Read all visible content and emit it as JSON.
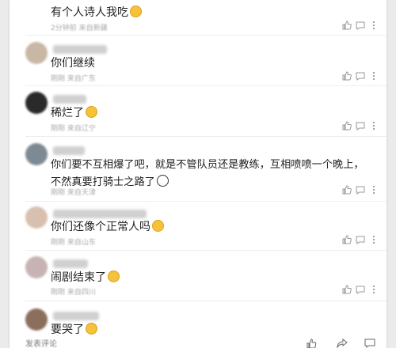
{
  "comments": [
    {
      "username_hidden": true,
      "text": "有个人诗人我吃",
      "emoji": "smile-emoji",
      "meta": "2分钟前 来自新疆",
      "actions": [
        "like-icon",
        "comment-icon",
        "more-icon"
      ]
    },
    {
      "username_hidden": true,
      "text": "你们继续",
      "emoji": "",
      "meta": "刚刚 来自广东",
      "actions": [
        "like-icon",
        "comment-icon",
        "more-icon"
      ]
    },
    {
      "username_hidden": true,
      "text": "稀烂了",
      "emoji": "smirk-emoji",
      "meta": "刚刚 来自辽宁",
      "actions": [
        "like-icon",
        "comment-icon",
        "more-icon"
      ]
    },
    {
      "username_hidden": true,
      "text": "你们要不互相爆了吧，就是不管队员还是教练，互相喷喷一个晚上，不然真要打骑士之路了",
      "emoji": "panda-emoji",
      "meta": "刚刚 来自天津",
      "actions": [
        "like-icon",
        "comment-icon",
        "more-icon"
      ]
    },
    {
      "username_hidden": true,
      "text": "你们还像个正常人吗",
      "emoji": "smile-emoji",
      "meta": "刚刚 来自山东",
      "actions": [
        "like-icon",
        "comment-icon",
        "more-icon"
      ]
    },
    {
      "username_hidden": true,
      "text": "闹剧结束了",
      "emoji": "relieved-emoji",
      "meta": "刚刚 来自四川",
      "actions": [
        "like-icon",
        "comment-icon",
        "more-icon"
      ]
    },
    {
      "username_hidden": true,
      "text": "要哭了",
      "emoji": "teary-emoji",
      "meta": "",
      "actions": []
    }
  ],
  "footer": {
    "compose_label": "发表评论",
    "icons": [
      "like-icon",
      "share-icon",
      "comment-icon"
    ]
  },
  "colors": {
    "avatar_1": "#c9b7a6",
    "avatar_2": "#2a2a2a",
    "avatar_3": "#7d8a94",
    "avatar_4": "#d8c0b0",
    "avatar_5": "#c7b3b3",
    "avatar_6": "#8c6e5d",
    "username_blur": "#c8c8c8"
  }
}
